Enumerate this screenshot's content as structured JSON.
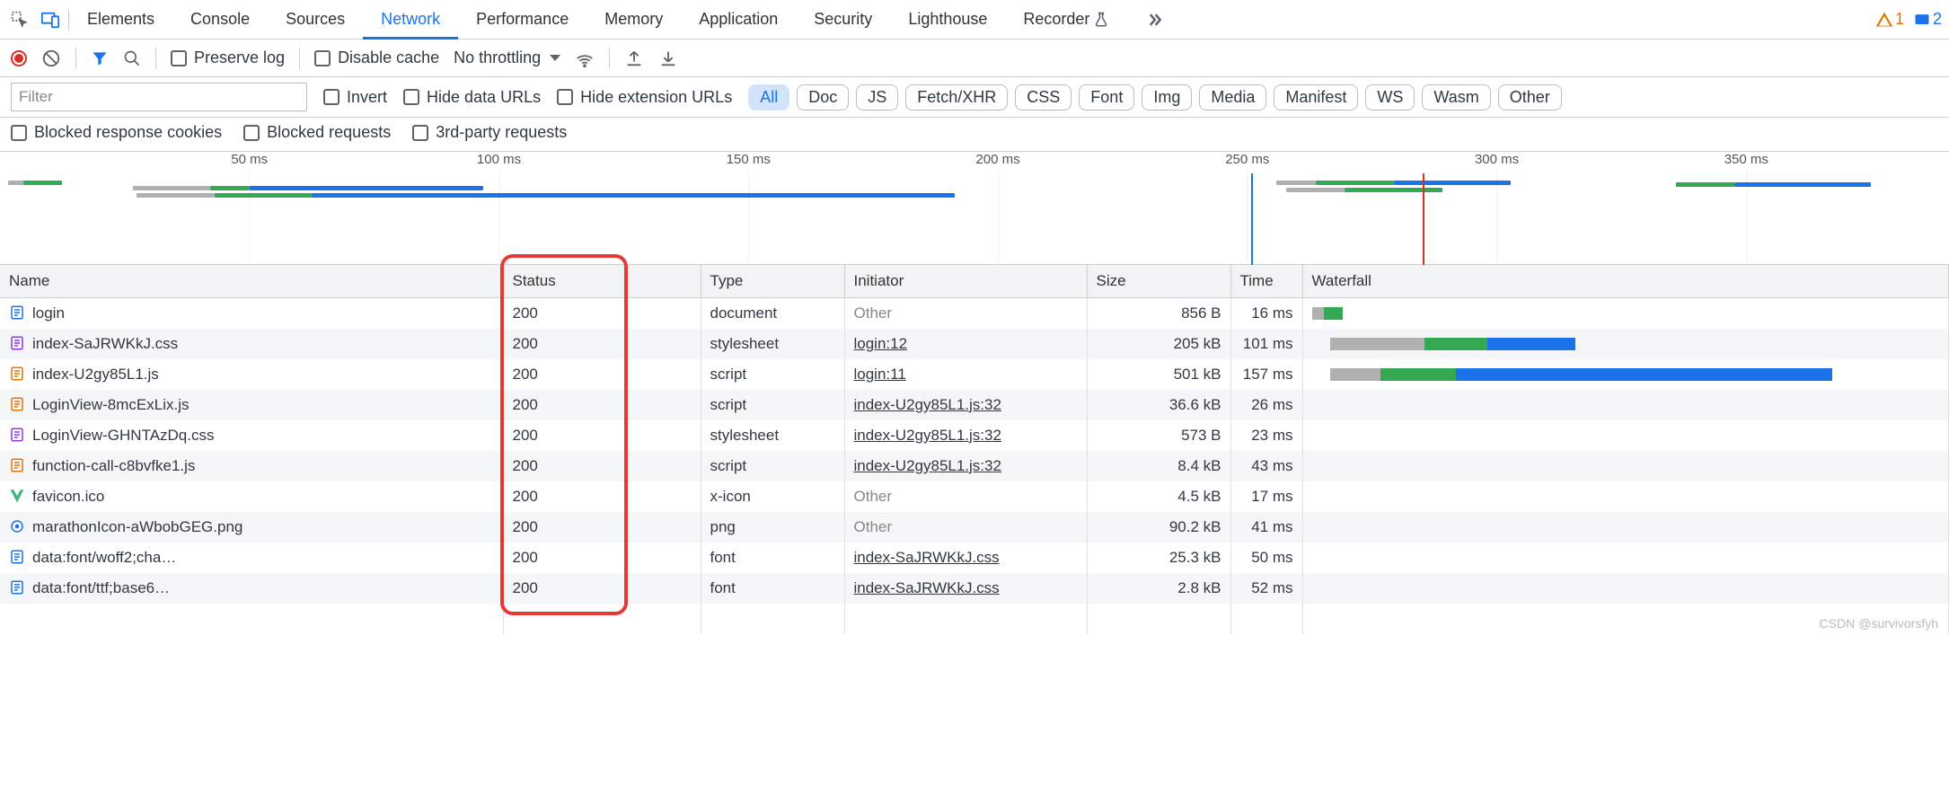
{
  "tabs": {
    "items": [
      "Elements",
      "Console",
      "Sources",
      "Network",
      "Performance",
      "Memory",
      "Application",
      "Security",
      "Lighthouse",
      "Recorder"
    ],
    "active": "Network"
  },
  "badges": {
    "warn": "1",
    "msg": "2"
  },
  "toolbar": {
    "preserve_log": "Preserve log",
    "disable_cache": "Disable cache",
    "throttling": "No throttling"
  },
  "filter": {
    "placeholder": "Filter",
    "invert": "Invert",
    "hide_data_urls": "Hide data URLs",
    "hide_ext_urls": "Hide extension URLs",
    "types": [
      "All",
      "Doc",
      "JS",
      "Fetch/XHR",
      "CSS",
      "Font",
      "Img",
      "Media",
      "Manifest",
      "WS",
      "Wasm",
      "Other"
    ],
    "active_type": "All",
    "blocked_cookies": "Blocked response cookies",
    "blocked_requests": "Blocked requests",
    "third_party": "3rd-party requests"
  },
  "timeline": {
    "ticks": [
      "50 ms",
      "100 ms",
      "150 ms",
      "200 ms",
      "250 ms",
      "300 ms",
      "350 ms"
    ]
  },
  "table": {
    "headers": {
      "name": "Name",
      "status": "Status",
      "type": "Type",
      "initiator": "Initiator",
      "size": "Size",
      "time": "Time",
      "waterfall": "Waterfall"
    },
    "rows": [
      {
        "icon": "doc",
        "icon_color": "#1a73e8",
        "name": "login",
        "status": "200",
        "type": "document",
        "initiator": "Other",
        "initiator_link": false,
        "size": "856 B",
        "time": "16 ms",
        "wf": [
          {
            "l": 0,
            "w": 2,
            "c": "#b0b0b0"
          },
          {
            "l": 2,
            "w": 3,
            "c": "#34a853"
          }
        ]
      },
      {
        "icon": "css",
        "icon_color": "#9334e6",
        "name": "index-SaJRWKkJ.css",
        "status": "200",
        "type": "stylesheet",
        "initiator": "login:12",
        "initiator_link": true,
        "size": "205 kB",
        "time": "101 ms",
        "wf": [
          {
            "l": 3,
            "w": 15,
            "c": "#b0b0b0"
          },
          {
            "l": 18,
            "w": 10,
            "c": "#34a853"
          },
          {
            "l": 28,
            "w": 14,
            "c": "#1a73e8"
          }
        ]
      },
      {
        "icon": "js",
        "icon_color": "#e37400",
        "name": "index-U2gy85L1.js",
        "status": "200",
        "type": "script",
        "initiator": "login:11",
        "initiator_link": true,
        "size": "501 kB",
        "time": "157 ms",
        "wf": [
          {
            "l": 3,
            "w": 8,
            "c": "#b0b0b0"
          },
          {
            "l": 11,
            "w": 12,
            "c": "#34a853"
          },
          {
            "l": 23,
            "w": 60,
            "c": "#1a73e8"
          }
        ]
      },
      {
        "icon": "js",
        "icon_color": "#e37400",
        "name": "LoginView-8mcExLix.js",
        "status": "200",
        "type": "script",
        "initiator": "index-U2gy85L1.js:32",
        "initiator_link": true,
        "size": "36.6 kB",
        "time": "26 ms",
        "wf": []
      },
      {
        "icon": "css",
        "icon_color": "#9334e6",
        "name": "LoginView-GHNTAzDq.css",
        "status": "200",
        "type": "stylesheet",
        "initiator": "index-U2gy85L1.js:32",
        "initiator_link": true,
        "size": "573 B",
        "time": "23 ms",
        "wf": []
      },
      {
        "icon": "js",
        "icon_color": "#e37400",
        "name": "function-call-c8bvfke1.js",
        "status": "200",
        "type": "script",
        "initiator": "index-U2gy85L1.js:32",
        "initiator_link": true,
        "size": "8.4 kB",
        "time": "43 ms",
        "wf": []
      },
      {
        "icon": "vue",
        "icon_color": "#41b883",
        "name": "favicon.ico",
        "status": "200",
        "type": "x-icon",
        "initiator": "Other",
        "initiator_link": false,
        "size": "4.5 kB",
        "time": "17 ms",
        "wf": []
      },
      {
        "icon": "img",
        "icon_color": "#1a73e8",
        "name": "marathonIcon-aWbobGEG.png",
        "status": "200",
        "type": "png",
        "initiator": "Other",
        "initiator_link": false,
        "size": "90.2 kB",
        "time": "41 ms",
        "wf": []
      },
      {
        "icon": "font",
        "icon_color": "#1a73e8",
        "name": "data:font/woff2;cha…",
        "status": "200",
        "type": "font",
        "initiator": "index-SaJRWKkJ.css",
        "initiator_link": true,
        "size": "25.3 kB",
        "time": "50 ms",
        "wf": []
      },
      {
        "icon": "font",
        "icon_color": "#1a73e8",
        "name": "data:font/ttf;base6…",
        "status": "200",
        "type": "font",
        "initiator": "index-SaJRWKkJ.css",
        "initiator_link": true,
        "size": "2.8 kB",
        "time": "52 ms",
        "wf": []
      }
    ]
  },
  "watermark": "CSDN @survivorsfyh"
}
